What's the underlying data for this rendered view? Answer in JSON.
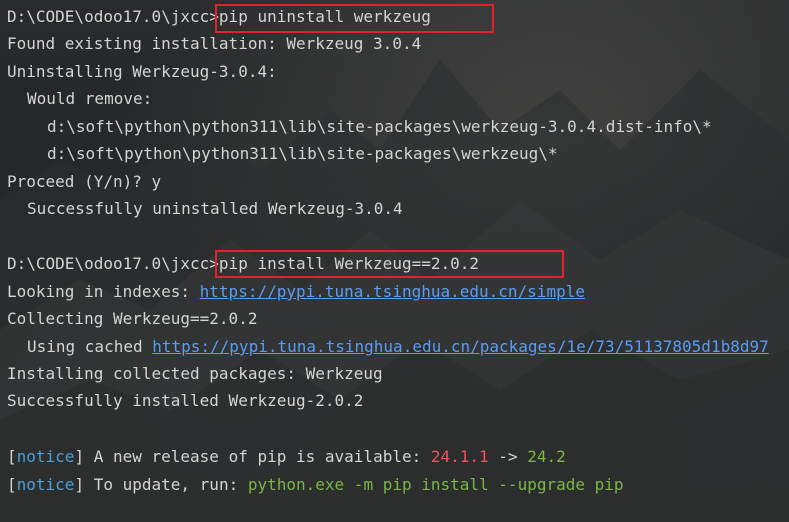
{
  "terminal": {
    "lines": {
      "l1_prompt": "D:\\CODE\\odoo17.0\\jxcc>",
      "l1_cmd": "pip uninstall werkzeug",
      "l2": "Found existing installation: Werkzeug 3.0.4",
      "l3": "Uninstalling Werkzeug-3.0.4:",
      "l4": "Would remove:",
      "l5": "d:\\soft\\python\\python311\\lib\\site-packages\\werkzeug-3.0.4.dist-info\\*",
      "l6": "d:\\soft\\python\\python311\\lib\\site-packages\\werkzeug\\*",
      "l7": "Proceed (Y/n)? y",
      "l8": "Successfully uninstalled Werkzeug-3.0.4",
      "l9_prompt": "D:\\CODE\\odoo17.0\\jxcc>",
      "l9_cmd": "pip install Werkzeug==2.0.2",
      "l10_text": "Looking in indexes: ",
      "l10_link": "https://pypi.tuna.tsinghua.edu.cn/simple",
      "l11": "Collecting Werkzeug==2.0.2",
      "l12_text": "Using cached ",
      "l12_link": "https://pypi.tuna.tsinghua.edu.cn/packages/1e/73/51137805d1b8d97",
      "l13": "Installing collected packages: Werkzeug",
      "l14": "Successfully installed Werkzeug-2.0.2",
      "l15_open": "[",
      "l15_notice": "notice",
      "l15_close": "]",
      "l15_text": " A new release of pip is available: ",
      "l15_old": "24.1.1",
      "l15_arrow": " -> ",
      "l15_new": "24.2",
      "l16_open": "[",
      "l16_notice": "notice",
      "l16_close": "]",
      "l16_text": " To update, run: ",
      "l16_cmd": "python.exe -m pip install --upgrade pip"
    }
  },
  "colors": {
    "highlight": "#e3202b",
    "link": "#5b9cf3",
    "notice": "#4e9ed8",
    "old_version": "#f0525a",
    "new_version": "#7ab648"
  }
}
